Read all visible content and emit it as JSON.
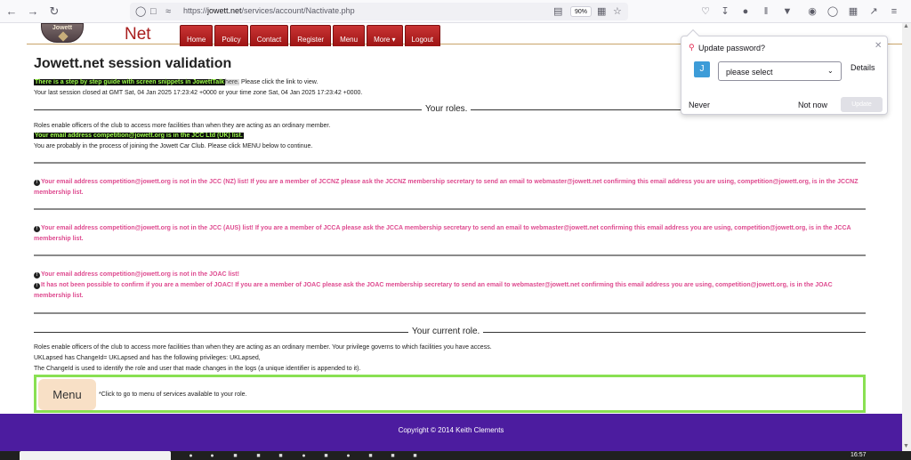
{
  "browser": {
    "url_prefix": "https://",
    "url_domain": "jowett.net",
    "url_path": "/services/account/Nactivate.php",
    "zoom": "90%"
  },
  "site": {
    "logo_text": "Jowett",
    "brand": "Net",
    "nav": [
      "Home",
      "Policy",
      "Contact",
      "Register",
      "Menu",
      "More ▾",
      "Logout"
    ]
  },
  "content": {
    "title": "Jowett.net session validation",
    "guide_link": "There is a step by step guide with screen snippets in JowettTalk",
    "here": "here.",
    "guide_suffix": " Please click the link to view.",
    "last_session": "Your last session closed at GMT Sat, 04 Jan 2025 17:23:42 +0000 or your time zone Sat, 04 Jan 2025 17:23:42 +0000.",
    "roles_heading": "Your roles.",
    "roles_intro": "Roles enable officers of the club to access more facilities than when they are acting as an ordinary member.",
    "jcc_uk": "Your email address competition@jowett.org is in the JCC Ltd (UK) list.",
    "joining": "You are probably in the process of joining the Jowett Car Club. Please click MENU below to continue.",
    "nz_warning": "Your email address competition@jowett.org is not in the JCC (NZ) list! If you are a member of JCCNZ please ask the JCCNZ membership secretary to send an email to webmaster@jowett.net confirming this email address you are using, competition@jowett.org, is in the JCCNZ membership list.",
    "aus_warning": "Your email address competition@jowett.org is not in the JCC (AUS) list! If you are a member of JCCA please ask the JCCA membership secretary to send an email to webmaster@jowett.net confirming this email address you are using, competition@jowett.org, is in the JCCA membership list.",
    "joac_warning": "Your email address competition@jowett.org is not in the JOAC list!",
    "joac_confirm": "It has not been possible to confirm if you are a member of JOAC! If you are a member of JOAC please ask the JOAC membership secretary to send an email to webmaster@jowett.net confirming this email address you are using, competition@jowett.org, is in the JOAC membership list.",
    "current_role_heading": "Your current role.",
    "current_role_intro": "Roles enable officers of the club to access more facilities than when they are acting as an ordinary member. Your privilege governs to which facilities you have access.",
    "changeid": "UKLapsed has ChangeId= UKLapsed and has the following privileges: UKLapsed,",
    "changeid_note": "The ChangeId is used to identify the role and user that made changes in the logs (a unique identifier is appended to it).",
    "menu_button": "Menu",
    "menu_hint": "*Click to go to menu of services available to your role."
  },
  "footer": {
    "copyright": "Copyright © 2014 Keith Clements"
  },
  "popup": {
    "title": "Update password?",
    "avatar_letter": "J",
    "select_value": "please select",
    "details": "Details",
    "never": "Never",
    "not_now": "Not now",
    "update": "Update"
  },
  "taskbar": {
    "clock": "16:57"
  },
  "colors": {
    "nav_red": "#b52222",
    "brand_red": "#a81d1d",
    "warning_pink": "#de4a8f",
    "highlight_green": "#9dff4a",
    "menu_border": "#89e052",
    "footer_purple": "#4c1c9f"
  }
}
